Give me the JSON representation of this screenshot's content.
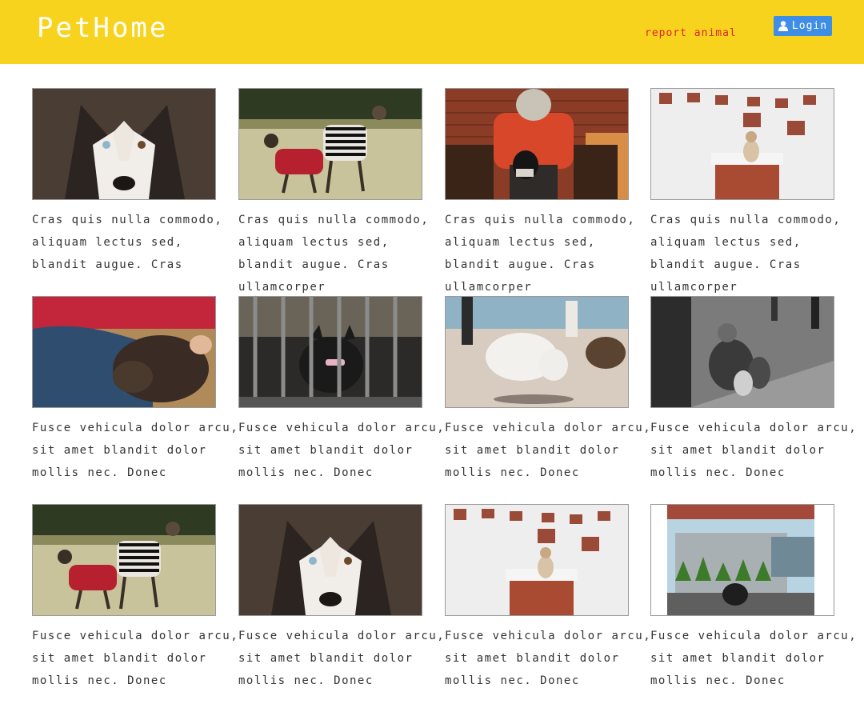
{
  "header": {
    "brand": "PetHome",
    "report_link": "report animal",
    "login_label": "Login",
    "login_icon": "user-icon",
    "colors": {
      "background": "#f8d31e",
      "report_link": "#d9262a",
      "login_button": "#3e8ee6"
    }
  },
  "cards": [
    {
      "image": "husky-closeup",
      "caption": "Cras quis nulla commodo, aliquam lectus sed, blandit augue. Cras"
    },
    {
      "image": "greyhounds-in-sweaters",
      "caption": "Cras quis nulla commodo, aliquam lectus sed, blandit augue. Cras ullamcorper"
    },
    {
      "image": "man-with-dog-brick-wall",
      "caption": "Cras quis nulla commodo, aliquam lectus sed, blandit augue. Cras ullamcorper"
    },
    {
      "image": "dog-in-snow-on-crates",
      "caption": "Cras quis nulla commodo, aliquam lectus sed, blandit augue. Cras ullamcorper"
    },
    {
      "image": "dog-lying-on-person",
      "caption": "Fusce vehicula dolor arcu, sit amet blandit dolor mollis nec. Donec"
    },
    {
      "image": "french-bulldog-behind-fence",
      "caption": "Fusce vehicula dolor arcu, sit amet blandit dolor mollis nec. Donec"
    },
    {
      "image": "white-dog-on-beach",
      "caption": "Fusce vehicula dolor arcu, sit amet blandit dolor mollis nec. Donec"
    },
    {
      "image": "man-with-dogs-on-street",
      "caption": "Fusce vehicula dolor arcu, sit amet blandit dolor mollis nec. Donec"
    },
    {
      "image": "greyhounds-in-sweaters",
      "caption": "Fusce vehicula dolor arcu, sit amet blandit dolor mollis nec. Donec"
    },
    {
      "image": "husky-closeup",
      "caption": "Fusce vehicula dolor arcu, sit amet blandit dolor mollis nec. Donec"
    },
    {
      "image": "dog-in-snow-on-crates",
      "caption": "Fusce vehicula dolor arcu, sit amet blandit dolor mollis nec. Donec"
    },
    {
      "image": "dog-by-concrete-wall",
      "caption": "Fusce vehicula dolor arcu, sit amet blandit dolor mollis nec. Donec"
    }
  ]
}
